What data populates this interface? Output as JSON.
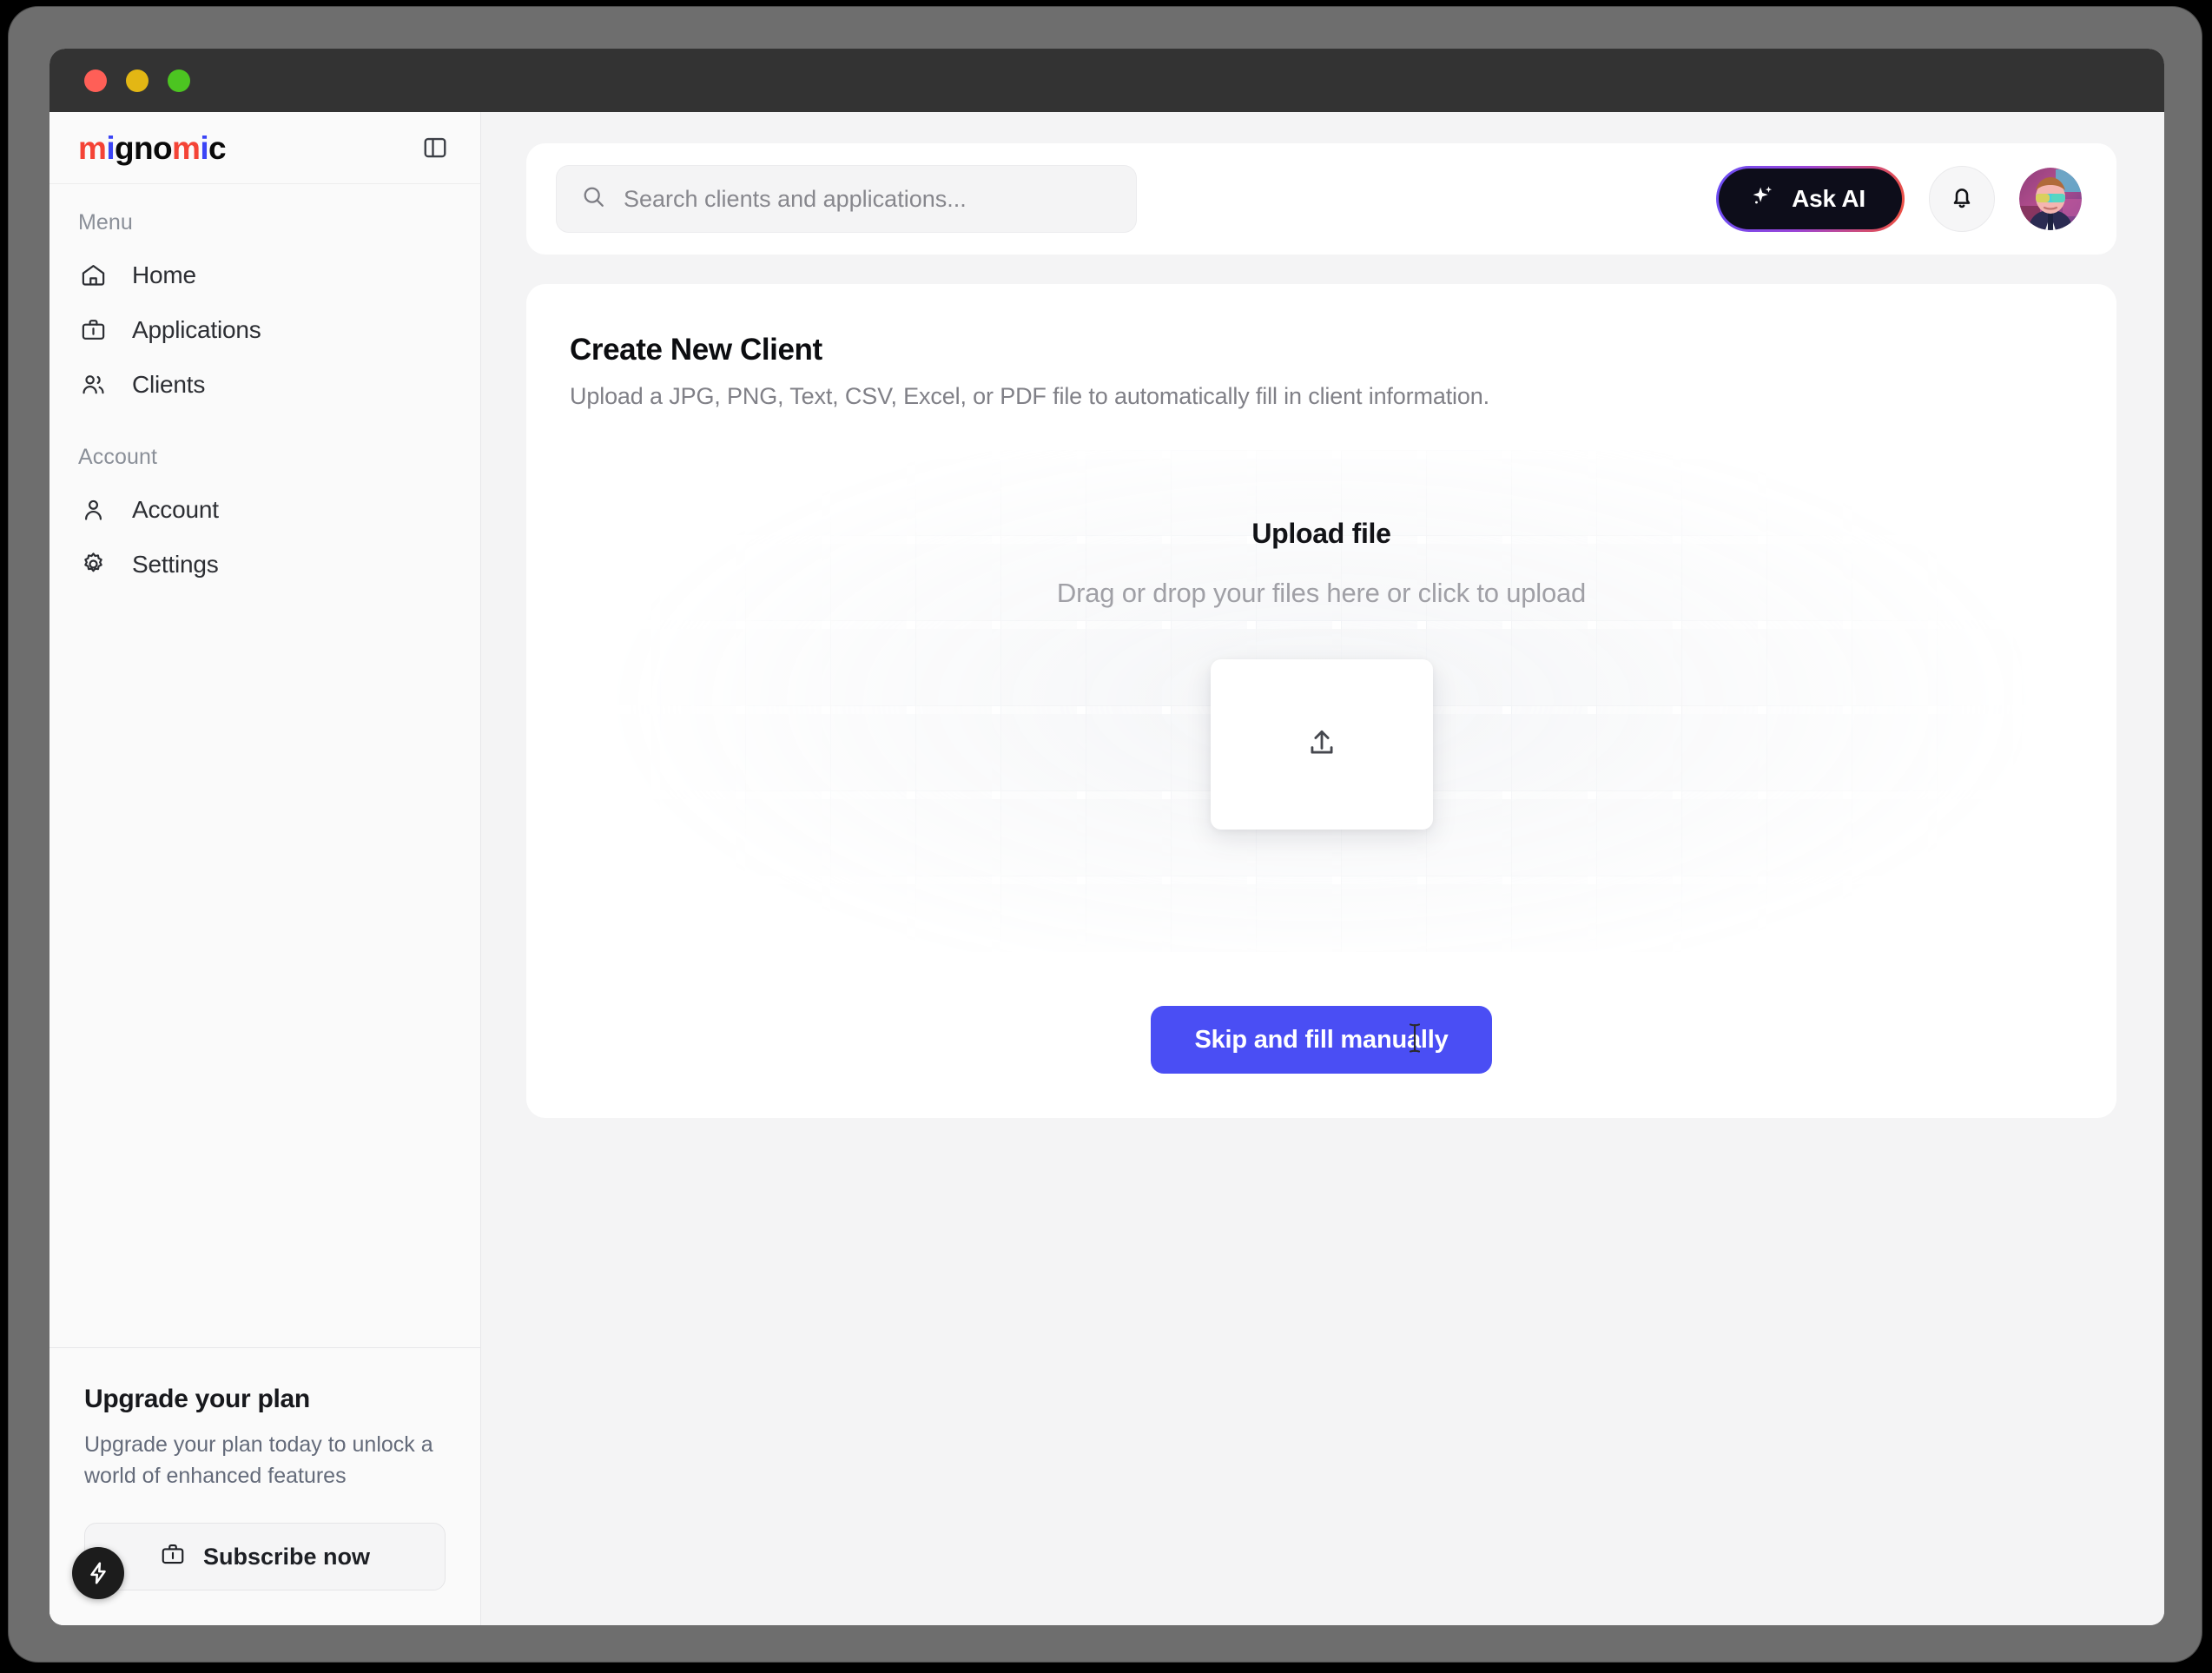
{
  "window": {
    "traffic_lights": [
      "close",
      "minimize",
      "maximize"
    ]
  },
  "sidebar": {
    "logo": {
      "full": "mignomic",
      "parts": [
        {
          "text": "m",
          "color": "#f44336"
        },
        {
          "text": "i",
          "color": "#3b44f6"
        },
        {
          "text": "gno",
          "color": "#0a0a0a"
        },
        {
          "text": "m",
          "color": "#f44336"
        },
        {
          "text": "i",
          "color": "#3b44f6"
        },
        {
          "text": "c",
          "color": "#0a0a0a"
        }
      ]
    },
    "panel_toggle_icon": "sidebar-toggle-icon",
    "groups": [
      {
        "label": "Menu",
        "items": [
          {
            "label": "Home",
            "icon": "home-icon"
          },
          {
            "label": "Applications",
            "icon": "briefcase-icon"
          },
          {
            "label": "Clients",
            "icon": "users-icon"
          }
        ]
      },
      {
        "label": "Account",
        "items": [
          {
            "label": "Account",
            "icon": "user-icon"
          },
          {
            "label": "Settings",
            "icon": "gear-icon"
          }
        ]
      }
    ],
    "upgrade": {
      "title": "Upgrade your plan",
      "description": "Upgrade your plan today to unlock a world of enhanced features",
      "button_label": "Subscribe now",
      "button_icon": "briefcase-icon"
    },
    "fab_icon": "lightning-bolt-icon"
  },
  "topbar": {
    "search": {
      "placeholder": "Search clients and applications...",
      "value": "",
      "icon": "search-icon"
    },
    "ask_ai": {
      "label": "Ask AI",
      "icon": "sparkle-icon",
      "gradient_from": "#6a4ef5",
      "gradient_to": "#f0513e",
      "background": "#0d0d1a"
    },
    "notifications_icon": "bell-icon",
    "avatar": "user-avatar"
  },
  "main": {
    "title": "Create New Client",
    "subtitle": "Upload a JPG, PNG, Text, CSV, Excel, or PDF file to automatically fill in client information.",
    "dropzone": {
      "title": "Upload file",
      "hint": "Drag or drop your files here or click to upload",
      "tile_icon": "upload-arrow-icon"
    },
    "skip_button": {
      "label": "Skip and fill manually",
      "color": "#4a4ef4"
    },
    "cursor": "text-ibeam-cursor"
  }
}
